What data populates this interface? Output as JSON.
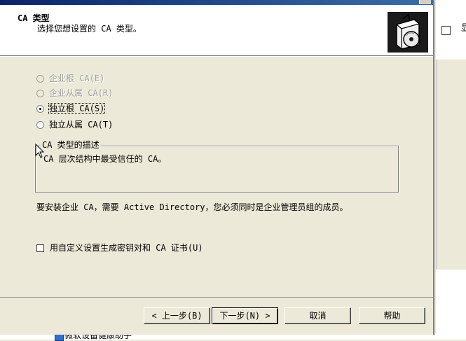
{
  "header": {
    "title": "CA 类型",
    "subtitle": "选择您想设置的 CA 类型。"
  },
  "ca_types": [
    {
      "label": "企业根 CA(E)",
      "checked": false,
      "disabled": true
    },
    {
      "label": "企业从属 CA(R)",
      "checked": false,
      "disabled": true
    },
    {
      "label": "独立根 CA(S)",
      "checked": true,
      "disabled": false
    },
    {
      "label": "独立从属 CA(T)",
      "checked": false,
      "disabled": false
    }
  ],
  "description": {
    "legend": "CA 类型的描述",
    "text": "CA 层次结构中最受信任的 CA。"
  },
  "note": "要安装企业 CA，需要 Active Directory，您必须同时是企业管理员组的成员。",
  "custom_keys": {
    "label": "用自定义设置生成密钥对和 CA 证书(U)",
    "checked": false
  },
  "buttons": {
    "back": "< 上一步(B)",
    "next": "下一步(N) >",
    "cancel": "取消",
    "help": "帮助"
  },
  "background": {
    "right_char": "显",
    "bottom_text": "微软设备健康助手"
  },
  "colors": {
    "dialog_bg": "#ece9d8",
    "header_bg": "#ffffff",
    "disabled_text": "#a0a0a0"
  }
}
